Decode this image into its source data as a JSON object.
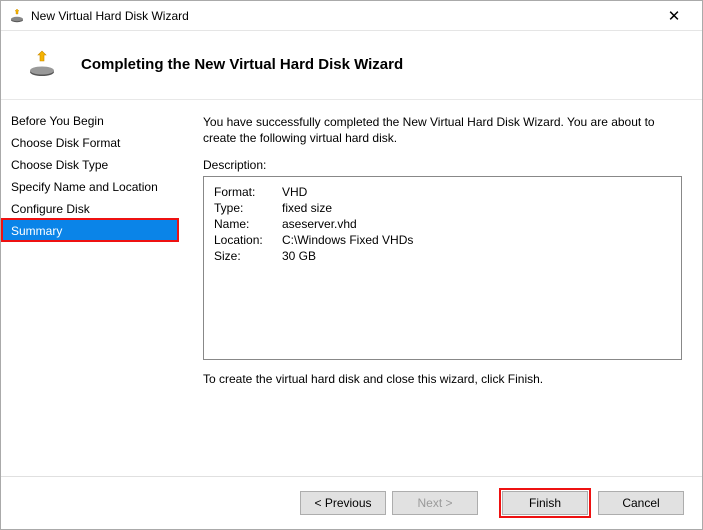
{
  "window": {
    "title": "New Virtual Hard Disk Wizard"
  },
  "header": {
    "heading": "Completing the New Virtual Hard Disk Wizard"
  },
  "sidebar": {
    "items": [
      {
        "label": "Before You Begin"
      },
      {
        "label": "Choose Disk Format"
      },
      {
        "label": "Choose Disk Type"
      },
      {
        "label": "Specify Name and Location"
      },
      {
        "label": "Configure Disk"
      },
      {
        "label": "Summary"
      }
    ],
    "active_index": 5
  },
  "content": {
    "intro": "You have successfully completed the New Virtual Hard Disk Wizard. You are about to create the following virtual hard disk.",
    "description_label": "Description:",
    "summary": {
      "format_label": "Format:",
      "format_value": "VHD",
      "type_label": "Type:",
      "type_value": "fixed size",
      "name_label": "Name:",
      "name_value": "aseserver.vhd",
      "location_label": "Location:",
      "location_value": "C:\\Windows Fixed VHDs",
      "size_label": "Size:",
      "size_value": "30 GB"
    },
    "outro": "To create the virtual hard disk and close this wizard, click Finish."
  },
  "buttons": {
    "previous": "< Previous",
    "next": "Next >",
    "finish": "Finish",
    "cancel": "Cancel"
  }
}
